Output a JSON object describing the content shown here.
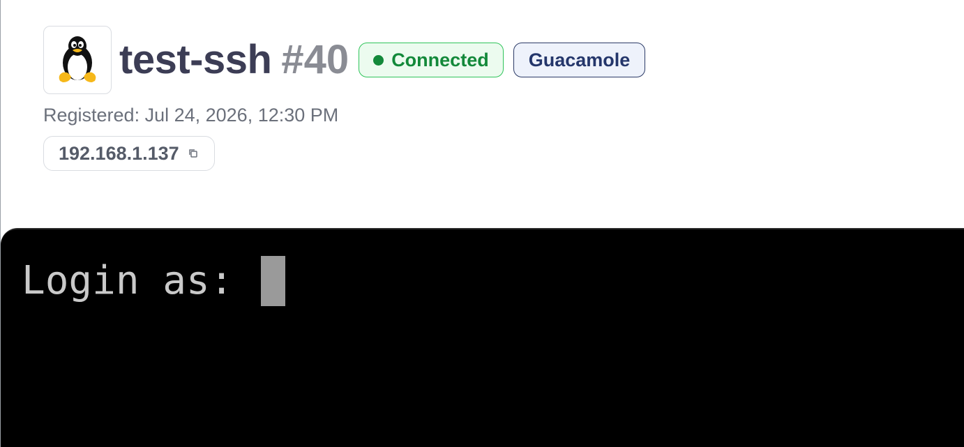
{
  "host": {
    "name": "test-ssh",
    "id": "#40",
    "os_icon": "linux-tux-icon",
    "status": {
      "label": "Connected",
      "color": "#13893a"
    },
    "protocol_badge": "Guacamole",
    "registered": "Registered: Jul 24, 2026, 12:30 PM",
    "ip": "192.168.1.137",
    "copy_icon": "copy-icon"
  },
  "terminal": {
    "prompt": "Login as: ",
    "background": "#000000",
    "foreground": "#c9c9c9"
  }
}
